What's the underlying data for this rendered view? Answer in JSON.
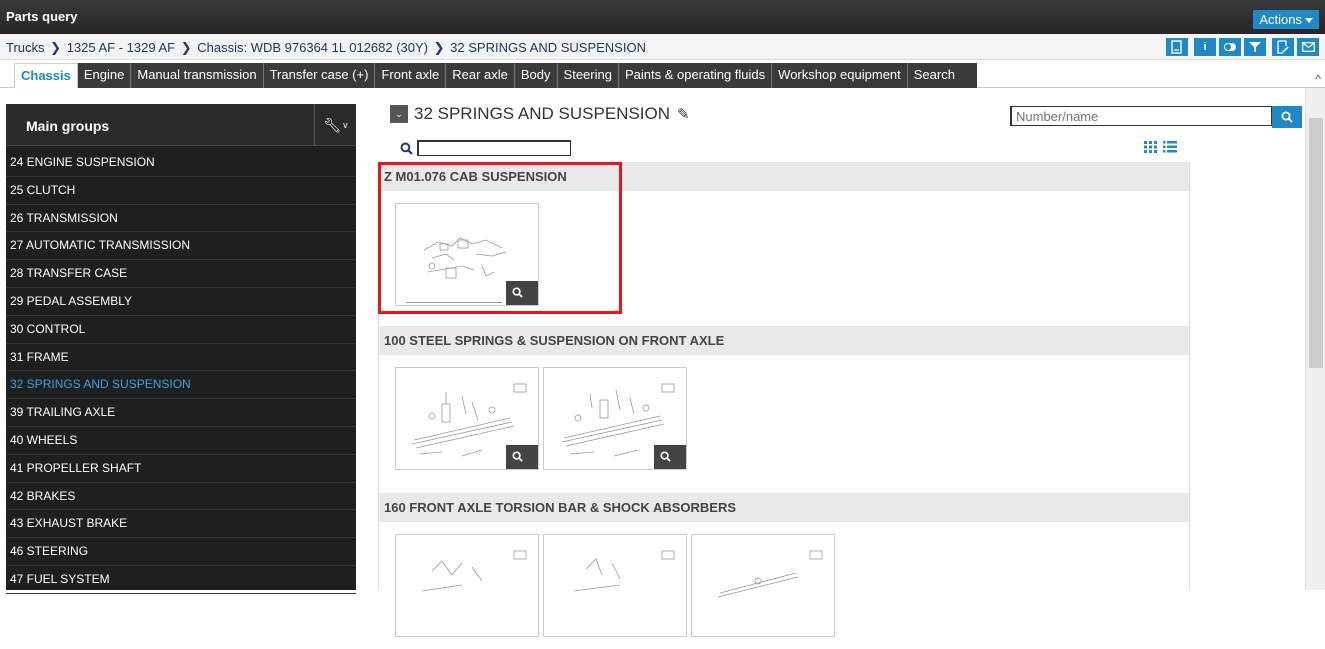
{
  "window": {
    "title": "Parts query",
    "actions_label": "Actions"
  },
  "breadcrumb": {
    "items": [
      "Trucks",
      "1325 AF - 1329 AF",
      "Chassis: WDB 976364 1L 012682 (30Y)",
      "32 SPRINGS AND SUSPENSION"
    ],
    "icons": [
      "print-preview-icon",
      "info-icon",
      "toggle-icon",
      "filter-icon",
      "notes-icon",
      "mail-icon"
    ]
  },
  "tabs": [
    "Chassis",
    "Engine",
    "Manual transmission",
    "Transfer case (+)",
    "Front axle",
    "Rear axle",
    "Body",
    "Steering",
    "Paints & operating fluids",
    "Workshop equipment",
    "Search"
  ],
  "active_tab": "Chassis",
  "sidebar": {
    "title": "Main groups",
    "items": [
      "24 ENGINE SUSPENSION",
      "25 CLUTCH",
      "26 TRANSMISSION",
      "27 AUTOMATIC TRANSMISSION",
      "28 TRANSFER CASE",
      "29 PEDAL ASSEMBLY",
      "30 CONTROL",
      "31 FRAME",
      "32 SPRINGS AND SUSPENSION",
      "39 TRAILING AXLE",
      "40 WHEELS",
      "41 PROPELLER SHAFT",
      "42 BRAKES",
      "43 EXHAUST BRAKE",
      "46 STEERING",
      "47 FUEL SYSTEM"
    ],
    "active_item": "32 SPRINGS AND SUSPENSION"
  },
  "main": {
    "title": "32 SPRINGS AND SUSPENSION",
    "search_placeholder": "Number/name",
    "filter_value": "",
    "groups": [
      {
        "heading": "Z M01.076 CAB SUSPENSION",
        "thumbnail_count": 1
      },
      {
        "heading": "100 STEEL SPRINGS & SUSPENSION ON FRONT AXLE",
        "thumbnail_count": 2
      },
      {
        "heading": "160 FRONT AXLE TORSION BAR & SHOCK ABSORBERS",
        "thumbnail_count": 3
      }
    ]
  },
  "colors": {
    "accent": "#1e88c8",
    "highlight": "#e8161b",
    "sidebar_bg": "#1f1f1f",
    "active_item": "#2ea6ea"
  }
}
